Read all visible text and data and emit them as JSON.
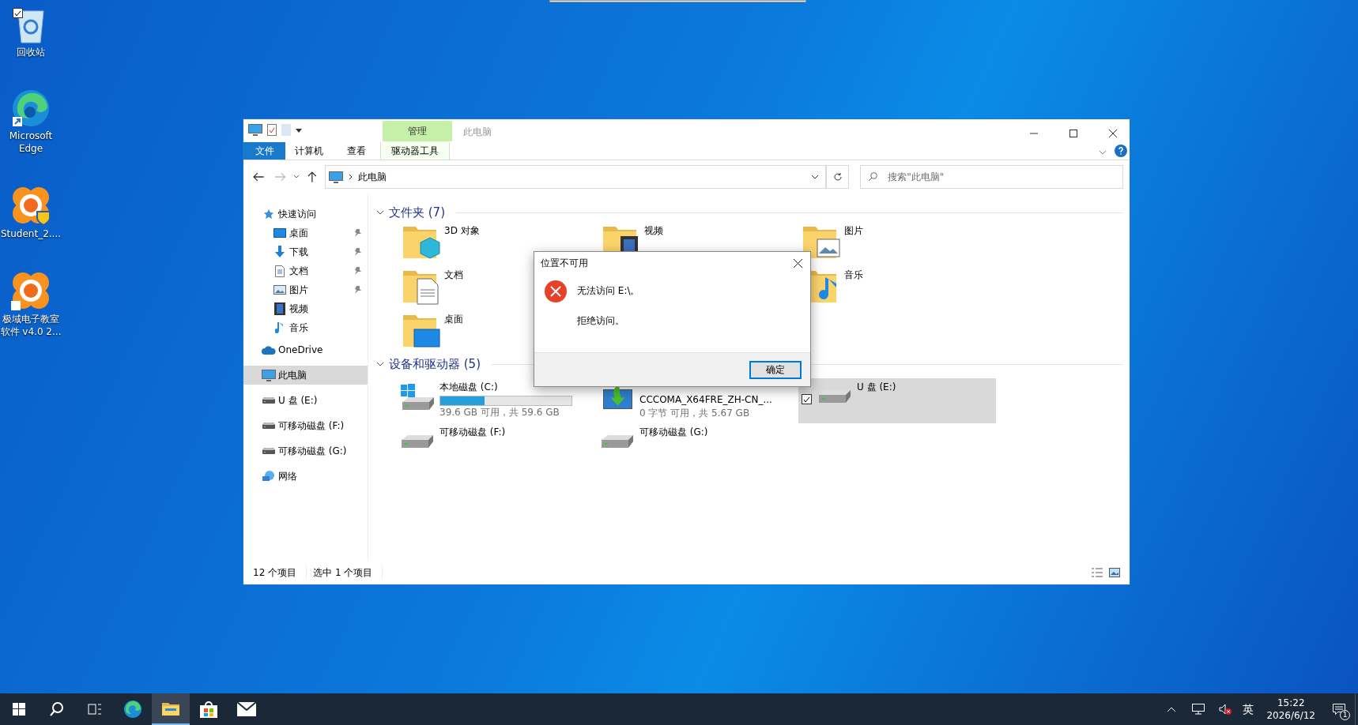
{
  "desktop_icons": [
    {
      "label": "回收站",
      "kind": "recycle",
      "checked": true
    },
    {
      "label": "Microsoft Edge",
      "kind": "edge",
      "checked": false
    },
    {
      "label": "Student_2....",
      "kind": "student",
      "checked": false
    },
    {
      "label": "极域电子教室软件 v4.0 2...",
      "kind": "classroom",
      "checked": false
    }
  ],
  "explorer": {
    "title": "此电脑",
    "context_tab": "管理",
    "ribbon_tabs": [
      {
        "label": "文件",
        "kind": "file"
      },
      {
        "label": "计算机",
        "kind": "tab"
      },
      {
        "label": "查看",
        "kind": "tab"
      },
      {
        "label": "驱动器工具",
        "kind": "context"
      }
    ],
    "address": "此电脑",
    "search": {
      "placeholder": "搜索\"此电脑\""
    },
    "nav": [
      {
        "label": "快速访问",
        "kind": "star",
        "selected": false,
        "children": [
          {
            "label": "桌面",
            "kind": "desktop",
            "selected": false,
            "pinned": true
          },
          {
            "label": "下载",
            "kind": "download",
            "selected": false,
            "pinned": true
          },
          {
            "label": "文档",
            "kind": "document",
            "selected": false,
            "pinned": true
          },
          {
            "label": "图片",
            "kind": "pictures",
            "selected": false,
            "pinned": true
          },
          {
            "label": "视频",
            "kind": "video",
            "selected": false,
            "pinned": false
          },
          {
            "label": "音乐",
            "kind": "music",
            "selected": false,
            "pinned": false
          }
        ]
      },
      {
        "label": "OneDrive",
        "kind": "cloud",
        "selected": false
      },
      {
        "label": "此电脑",
        "kind": "pc",
        "selected": true
      },
      {
        "label": "U 盘 (E:)",
        "kind": "drive",
        "selected": false
      },
      {
        "label": "可移动磁盘 (F:)",
        "kind": "drive",
        "selected": false
      },
      {
        "label": "可移动磁盘 (G:)",
        "kind": "drive",
        "selected": false
      },
      {
        "label": "网络",
        "kind": "network",
        "selected": false
      }
    ],
    "folders": {
      "header": "文件夹 (7)",
      "expanded": true,
      "rows": [
        [
          {
            "label": "3D 对象",
            "kind": "objects"
          },
          {
            "label": "视频",
            "kind": "video"
          },
          {
            "label": "图片",
            "kind": "pictures"
          }
        ],
        [
          {
            "label": "文档",
            "kind": "document"
          },
          null,
          {
            "label": "音乐",
            "kind": "music"
          }
        ],
        [
          {
            "label": "桌面",
            "kind": "desktop"
          }
        ]
      ]
    },
    "drives": {
      "header": "设备和驱动器 (5)",
      "expanded": true,
      "items": [
        {
          "label": "本地磁盘 (C:)",
          "kind": "system",
          "level": 0.336,
          "space": "39.6 GB 可用，共 59.6 GB",
          "selected": false
        },
        {
          "kind": "dvd",
          "volume": "CCCOMA_X64FRE_ZH-CN_...",
          "space": "0 字节 可用，共 5.67 GB",
          "selected": false
        },
        {
          "label": "U 盘 (E:)",
          "kind": "removable",
          "selected": true
        },
        {
          "label": "可移动磁盘 (F:)",
          "kind": "removable",
          "selected": false
        },
        {
          "label": "可移动磁盘 (G:)",
          "kind": "removable",
          "selected": false
        }
      ]
    },
    "status_bar": [
      "12 个项目",
      "选中 1 个项目"
    ]
  },
  "dialog": {
    "title": "位置不可用",
    "message": "无法访问 E:\\。",
    "detail": "拒绝访问。",
    "button": "确定"
  },
  "taskbar": {
    "apps": [
      {
        "kind": "start",
        "selected": false
      },
      {
        "kind": "search",
        "selected": false
      },
      {
        "kind": "taskview",
        "selected": false
      },
      {
        "kind": "edge",
        "selected": false
      },
      {
        "kind": "explorer",
        "selected": true
      },
      {
        "kind": "store",
        "selected": false
      },
      {
        "kind": "mail",
        "selected": false
      }
    ],
    "ime": "英",
    "time": "15:22",
    "date": "2026/6/12",
    "notifications": "1"
  }
}
